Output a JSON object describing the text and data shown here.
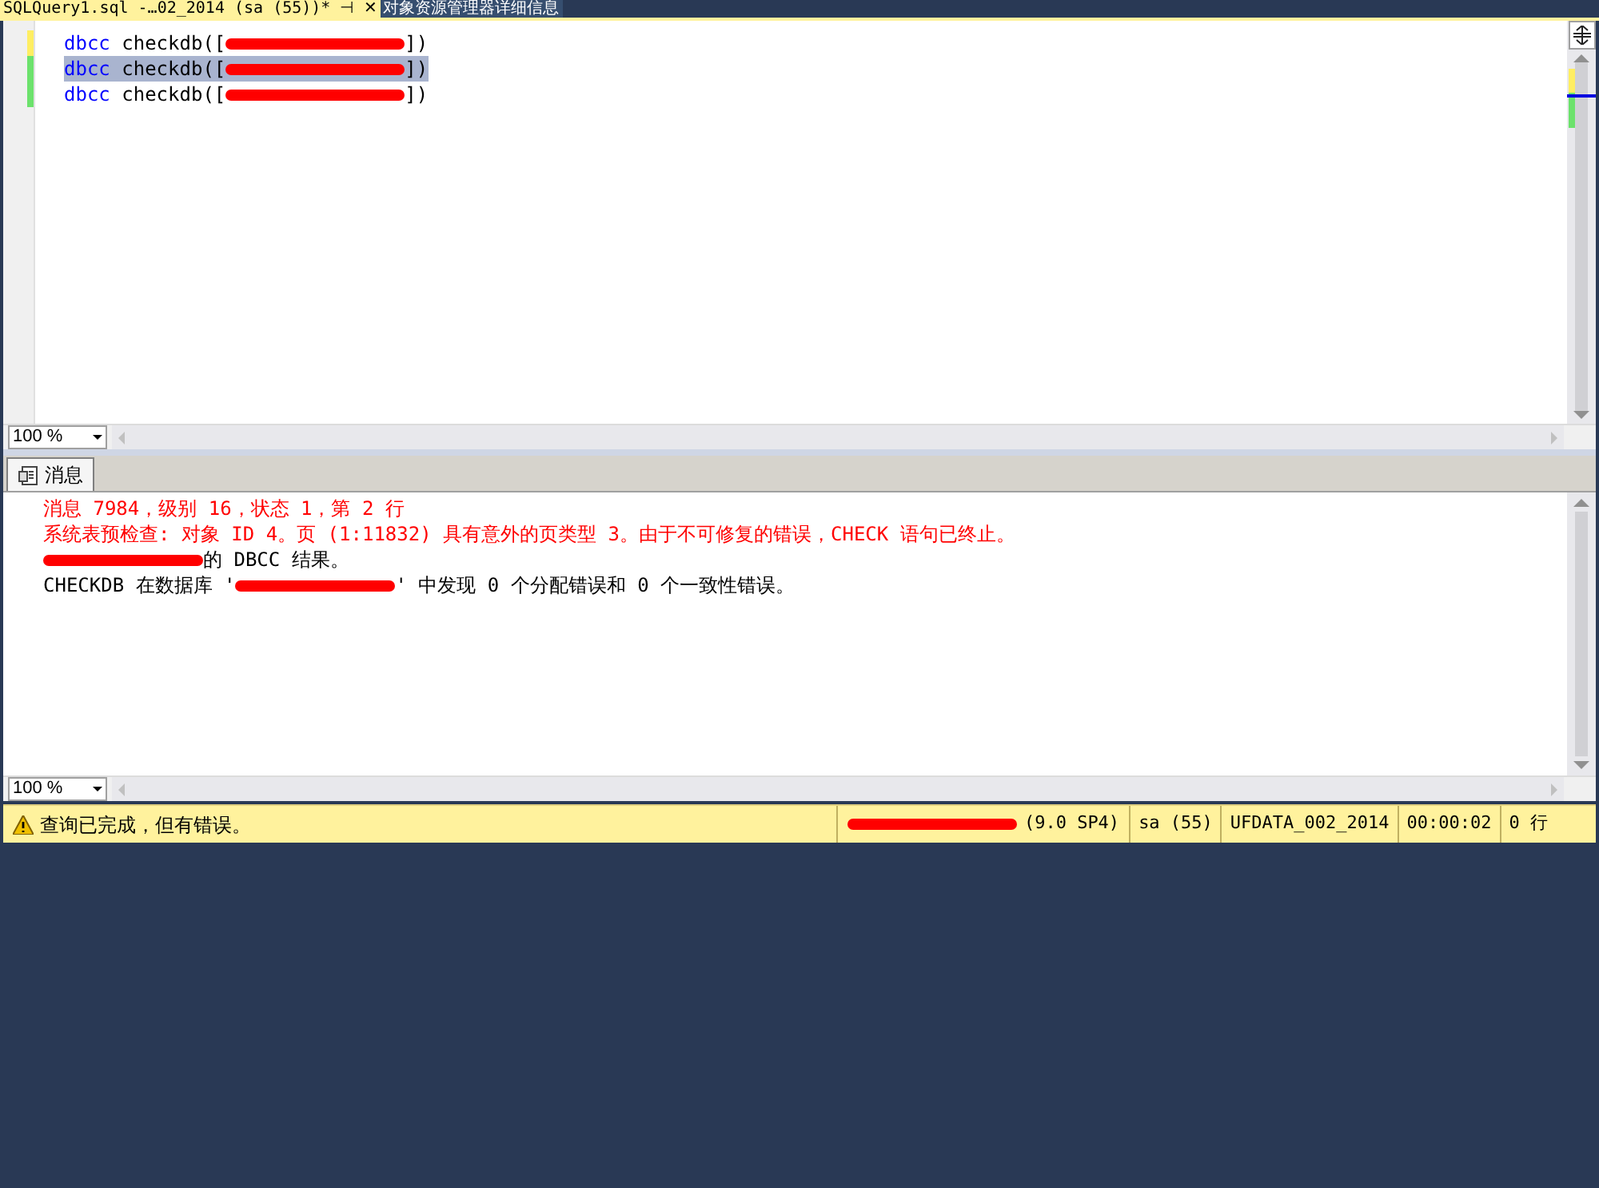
{
  "tabs": [
    {
      "label": "SQLQuery1.sql -…02_2014 (sa (55))*",
      "selected": true,
      "pin": "⊣",
      "close": "✕"
    },
    {
      "label": "对象资源管理器详细信息",
      "selected": false
    }
  ],
  "editor": {
    "lines": [
      {
        "saved": false,
        "selected": false,
        "parts": [
          {
            "kind": "keyword",
            "text": "dbcc"
          },
          {
            "kind": "text",
            "text": " checkdb(["
          },
          {
            "kind": "redacted"
          },
          {
            "kind": "text",
            "text": "])"
          }
        ]
      },
      {
        "saved": true,
        "selected": true,
        "parts": [
          {
            "kind": "keyword",
            "text": "dbcc"
          },
          {
            "kind": "text",
            "text": " checkdb(["
          },
          {
            "kind": "redacted"
          },
          {
            "kind": "text",
            "text": "])"
          }
        ]
      },
      {
        "saved": true,
        "selected": false,
        "parts": [
          {
            "kind": "keyword",
            "text": "dbcc"
          },
          {
            "kind": "text",
            "text": " checkdb(["
          },
          {
            "kind": "redacted"
          },
          {
            "kind": "text",
            "text": "])"
          }
        ]
      }
    ],
    "zoom": "100 %"
  },
  "results": {
    "tab": "消息",
    "zoom": "100 %",
    "messages": [
      {
        "kind": "error",
        "parts": [
          {
            "kind": "text",
            "text": "消息 7984，级别 16，状态 1，第 2 行"
          }
        ]
      },
      {
        "kind": "error",
        "parts": [
          {
            "kind": "text",
            "text": "系统表预检查: 对象 ID 4。页 (1:11832) 具有意外的页类型 3。由于不可修复的错误，CHECK 语句已终止。"
          }
        ]
      },
      {
        "kind": "info",
        "parts": [
          {
            "kind": "redacted"
          },
          {
            "kind": "text",
            "text": "的 DBCC 结果。"
          }
        ]
      },
      {
        "kind": "info",
        "parts": [
          {
            "kind": "text",
            "text": "CHECKDB 在数据库 '"
          },
          {
            "kind": "redacted"
          },
          {
            "kind": "text",
            "text": "' 中发现 0 个分配错误和 0 个一致性错误。"
          }
        ]
      }
    ]
  },
  "status_bar": {
    "message": "查询已完成，但有错误。",
    "server_version": "(9.0 SP4)",
    "user": "sa (55)",
    "database": "UFDATA_002_2014",
    "elapsed": "00:00:02",
    "rows": "0 行"
  }
}
